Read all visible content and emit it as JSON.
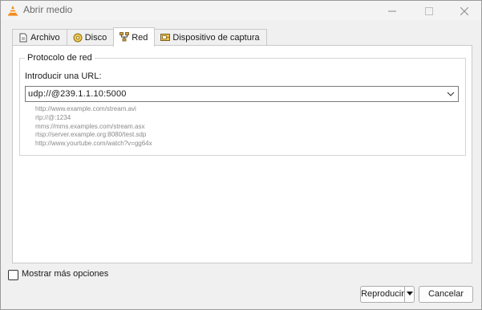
{
  "window": {
    "title": "Abrir medio",
    "icon": "vlc-cone-icon",
    "controls": [
      "minimize-icon",
      "maximize-icon",
      "close-icon"
    ]
  },
  "tabs": [
    {
      "label": "Archivo",
      "icon": "file-icon",
      "active": false
    },
    {
      "label": "Disco",
      "icon": "disc-icon",
      "active": false
    },
    {
      "label": "Red",
      "icon": "network-icon",
      "active": true
    },
    {
      "label": "Dispositivo de captura",
      "icon": "capture-device-icon",
      "active": false
    }
  ],
  "network": {
    "group_title": "Protocolo de red",
    "url_label": "Introducir una URL:",
    "url_value": "udp://@239.1.1.10:5000",
    "examples": [
      "http://www.example.com/stream.avi",
      "rtp://@:1234",
      "mms://mms.examples.com/stream.asx",
      "rtsp://server.example.org:8080/test.sdp",
      "http://www.yourtube.com/watch?v=gg64x"
    ]
  },
  "footer": {
    "more_options_label": "Mostrar más opciones",
    "more_options_checked": false,
    "play_label": "Reproducir",
    "cancel_label": "Cancelar"
  },
  "colors": {
    "vlc_orange": "#f28c1e",
    "background": "#f0f0f0",
    "panel": "#ffffff"
  }
}
